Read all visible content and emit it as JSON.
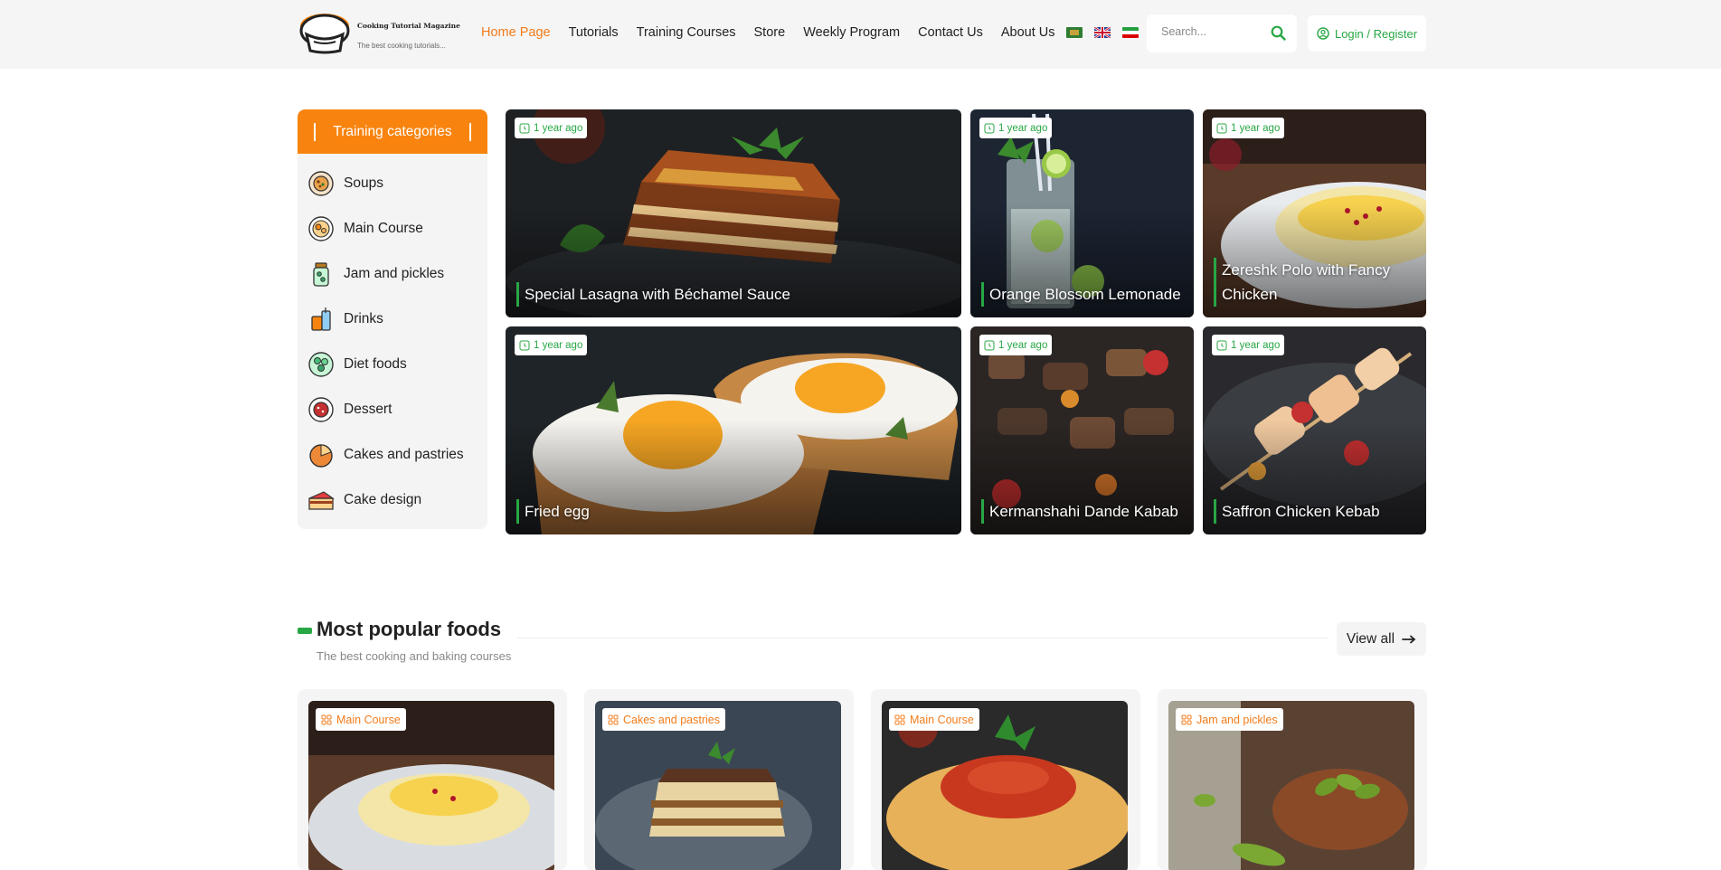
{
  "header": {
    "logo_title": "Cooking Tutorial Magazine",
    "logo_subtitle": "The best cooking tutorials...",
    "nav": [
      "Home Page",
      "Tutorials",
      "Training Courses",
      "Store",
      "Weekly Program",
      "Contact Us",
      "About Us"
    ],
    "active_nav": "Home Page",
    "search_placeholder": "Search...",
    "login_label": "Login / Register"
  },
  "sidebar": {
    "title": "Training categories",
    "items": [
      {
        "label": "Soups",
        "icon": "soup-bowl-icon"
      },
      {
        "label": "Main Course",
        "icon": "main-course-plate-icon"
      },
      {
        "label": "Jam and pickles",
        "icon": "jar-icon"
      },
      {
        "label": "Drinks",
        "icon": "drinks-icon"
      },
      {
        "label": "Diet foods",
        "icon": "salad-icon"
      },
      {
        "label": "Dessert",
        "icon": "dessert-icon"
      },
      {
        "label": "Cakes and pastries",
        "icon": "pie-icon"
      },
      {
        "label": "Cake design",
        "icon": "cake-slice-icon"
      }
    ]
  },
  "featured": [
    {
      "title": "Special Lasagna with Béchamel Sauce",
      "time": "1 year ago"
    },
    {
      "title": "Orange Blossom Lemonade",
      "time": "1 year ago"
    },
    {
      "title": "Zereshk Polo with Fancy Chicken",
      "time": "1 year ago"
    },
    {
      "title": "Fried egg",
      "time": "1 year ago"
    },
    {
      "title": "Kermanshahi Dande Kabab",
      "time": "1 year ago"
    },
    {
      "title": "Saffron Chicken Kebab",
      "time": "1 year ago"
    }
  ],
  "popular": {
    "title": "Most popular foods",
    "subtitle": "The best cooking and baking courses",
    "view_all": "View all",
    "cards": [
      {
        "category": "Main Course"
      },
      {
        "category": "Cakes and pastries"
      },
      {
        "category": "Main Course"
      },
      {
        "category": "Jam and pickles"
      }
    ]
  },
  "colors": {
    "accent_orange": "#f8840f",
    "accent_green": "#28a745"
  }
}
